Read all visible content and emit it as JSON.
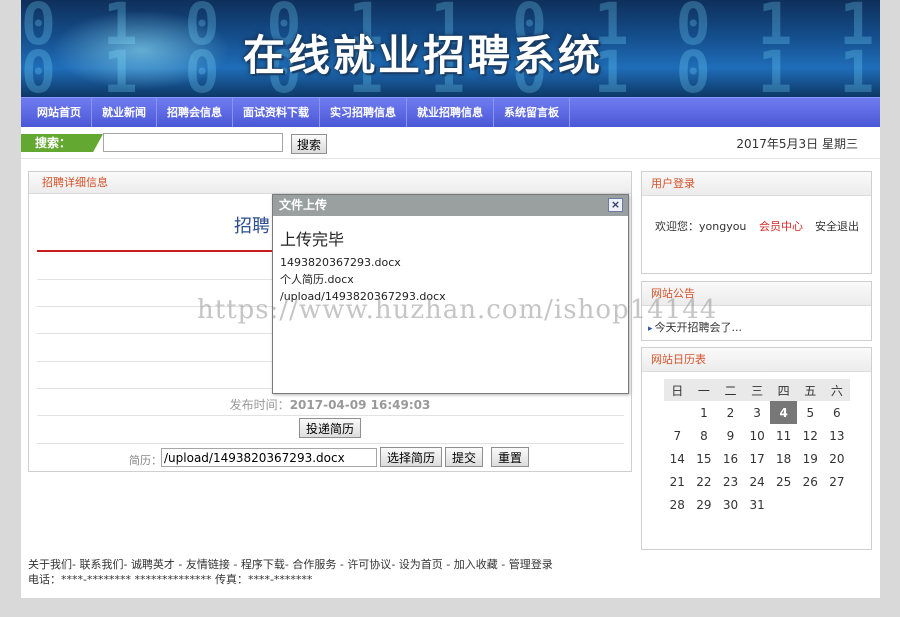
{
  "banner": {
    "title": "在线就业招聘系统",
    "digits": "0 1 0 0 1 1 0 1 0 1 1 0 0 1"
  },
  "nav": {
    "items": [
      "网站首页",
      "就业新闻",
      "招聘会信息",
      "面试资料下载",
      "实习招聘信息",
      "就业招聘信息",
      "系统留言板"
    ]
  },
  "search": {
    "label": "搜索：",
    "input_value": "",
    "button": "搜索",
    "date": "2017年5月3日 星期三"
  },
  "main": {
    "panel_title": "招聘详细信息",
    "detail_title": "招聘",
    "publish_label": "发布时间：",
    "publish_time": "2017-04-09 16:49:03",
    "submit_resume_button": "投递简历",
    "resume_label": "简历：",
    "resume_value": "/upload/1493820367293.docx",
    "choose_button": "选择简历",
    "submit_button": "提交",
    "reset_button": "重置"
  },
  "login": {
    "title": "用户登录",
    "welcome": "欢迎您：yongyou",
    "member_center": "会员中心",
    "logout": "安全退出"
  },
  "notice": {
    "title": "网站公告",
    "items": [
      "今天开招聘会了..."
    ]
  },
  "calendar": {
    "title": "网站日历表",
    "weekdays": [
      "日",
      "一",
      "二",
      "三",
      "四",
      "五",
      "六"
    ],
    "today": "3",
    "weeks": [
      [
        "",
        "",
        "1",
        "2",
        "3",
        "4",
        "5",
        "6"
      ],
      [
        "7",
        "8",
        "9",
        "10",
        "11",
        "12",
        "13"
      ],
      [
        "14",
        "15",
        "16",
        "17",
        "18",
        "19",
        "20"
      ],
      [
        "21",
        "22",
        "23",
        "24",
        "25",
        "26",
        "27"
      ],
      [
        "28",
        "29",
        "30",
        "31",
        "",
        "",
        ""
      ]
    ]
  },
  "footer": {
    "links": [
      "关于我们",
      "联系我们",
      "诚聘英才",
      "友情链接",
      "程序下载",
      "合作服务",
      "许可协议",
      "设为首页",
      "加入收藏",
      "管理登录"
    ],
    "contact": "电话：****-******** ************** 传真：****-*******"
  },
  "dialog": {
    "title": "文件上传",
    "close": "×",
    "status": "上传完毕",
    "lines": [
      "1493820367293.docx",
      "个人简历.docx",
      "/upload/1493820367293.docx"
    ]
  },
  "watermark": "https://www.huzhan.com/ishop14144"
}
